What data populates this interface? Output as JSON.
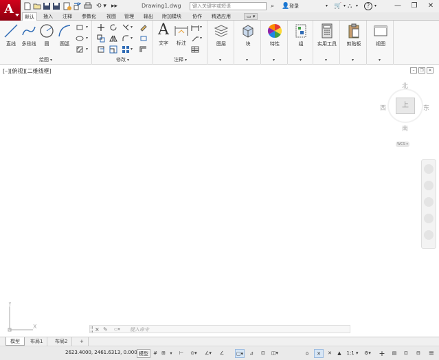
{
  "titlebar": {
    "logo": "A",
    "doc_title": "Drawing1.dwg",
    "search_placeholder": "键入关键字或短语",
    "login_label": "登录",
    "help_label": "?"
  },
  "tabs": [
    "默认",
    "插入",
    "注释",
    "参数化",
    "视图",
    "管理",
    "输出",
    "附加模块",
    "协作",
    "精选应用",
    "▭ ▾"
  ],
  "active_tab": "默认",
  "ribbon": {
    "draw": {
      "label": "绘图",
      "tools": [
        "直线",
        "多段线",
        "圆",
        "圆弧"
      ]
    },
    "modify": {
      "label": "修改"
    },
    "annotation": {
      "label": "注释",
      "tools": [
        "文字",
        "标注"
      ]
    },
    "layers": {
      "label": "图层"
    },
    "block": {
      "label": "块"
    },
    "properties": {
      "label": "特性"
    },
    "groups": {
      "label": "组"
    },
    "utilities": {
      "label": "实用工具"
    },
    "clipboard": {
      "label": "剪贴板"
    },
    "view": {
      "label": "视图"
    }
  },
  "viewport": {
    "label": "[–][俯视][二维线框]",
    "viewcube": {
      "north": "北",
      "south": "南",
      "east": "东",
      "west": "西",
      "face": "上",
      "wcs": "WCS ▾"
    },
    "ucs": {
      "x": "X",
      "y": "Y"
    }
  },
  "command_line": {
    "close": "×",
    "prompt_icon": "▭▾",
    "placeholder": "键入命令"
  },
  "layout_tabs": [
    "模型",
    "布局1",
    "布局2",
    "+"
  ],
  "active_layout": "模型",
  "status_bar": {
    "coordinates": "2623.4000, 2461.6313, 0.0000",
    "model_label": "模型",
    "scale_label": "1:1 ▾",
    "items": [
      "#",
      "⊞",
      "▾",
      "⊢",
      "⊙▾",
      "∠▾",
      "∠",
      "▢▾",
      "⊿",
      "⊡",
      "◫▾",
      "⌂",
      "✕",
      "✕",
      "▲",
      "⚙▾",
      "+",
      "▤",
      "⊡",
      "⊟",
      "≡"
    ]
  },
  "colors": {
    "logo_red": "#c4001a",
    "ribbon_bg": "#f7f7f7",
    "accent_blue": "#2f6bb5"
  }
}
